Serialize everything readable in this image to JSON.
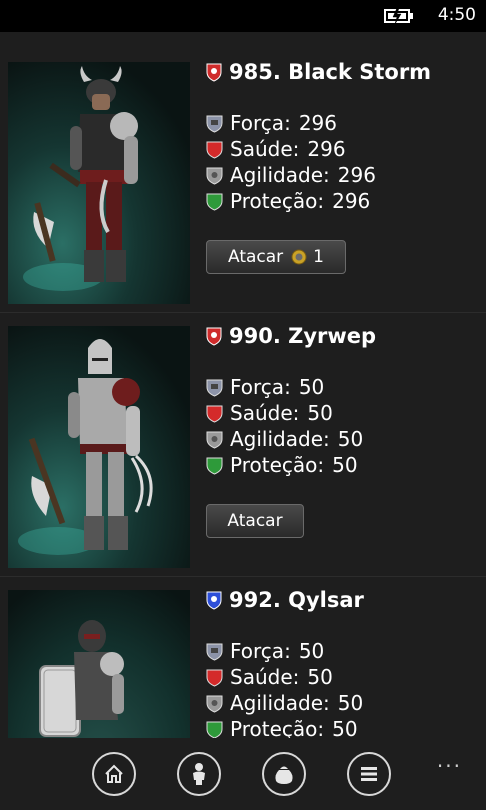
{
  "status": {
    "time": "4:50"
  },
  "players": [
    {
      "rank_name": "985. Black Storm",
      "badge": "red-badge",
      "stats": [
        {
          "label": "Força:",
          "value": "296",
          "icon": "force-shield-icon"
        },
        {
          "label": "Saúde:",
          "value": "296",
          "icon": "health-shield-icon"
        },
        {
          "label": "Agilidade:",
          "value": "296",
          "icon": "agility-shield-icon"
        },
        {
          "label": "Proteção:",
          "value": "296",
          "icon": "protection-shield-icon"
        }
      ],
      "attack_label": "Atacar",
      "attack_cost": "1"
    },
    {
      "rank_name": "990. Zyrwep",
      "badge": "red-badge",
      "stats": [
        {
          "label": "Força:",
          "value": "50",
          "icon": "force-shield-icon"
        },
        {
          "label": "Saúde:",
          "value": "50",
          "icon": "health-shield-icon"
        },
        {
          "label": "Agilidade:",
          "value": "50",
          "icon": "agility-shield-icon"
        },
        {
          "label": "Proteção:",
          "value": "50",
          "icon": "protection-shield-icon"
        }
      ],
      "attack_label": "Atacar"
    },
    {
      "rank_name": "992. Qylsar",
      "badge": "blue-badge",
      "stats": [
        {
          "label": "Força:",
          "value": "50",
          "icon": "force-shield-icon"
        },
        {
          "label": "Saúde:",
          "value": "50",
          "icon": "health-shield-icon"
        },
        {
          "label": "Agilidade:",
          "value": "50",
          "icon": "agility-shield-icon"
        },
        {
          "label": "Proteção:",
          "value": "50",
          "icon": "protection-shield-icon"
        }
      ]
    }
  ],
  "app_bar": {
    "buttons": [
      "home-icon",
      "character-icon",
      "bag-icon",
      "list-icon"
    ],
    "more": "..."
  },
  "colors": {
    "background": "#1e1e1e",
    "force": "#8c93a8",
    "health": "#d42a2a",
    "agility": "#9a9a9a",
    "protection": "#2e9a3a",
    "faction_red": "#cf2b2b",
    "faction_blue": "#2d4fd8"
  }
}
